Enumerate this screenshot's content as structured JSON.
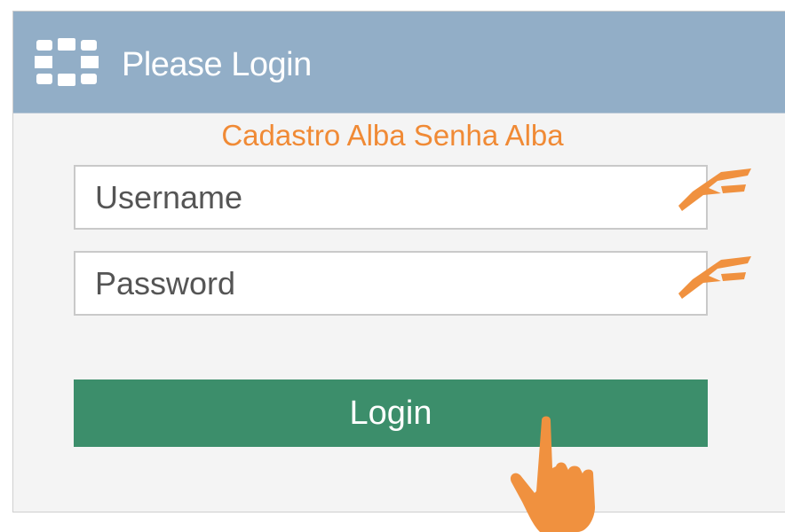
{
  "header": {
    "title": "Please Login",
    "logo_icon": "fortinet-logo-icon",
    "background_color": "#92aec7"
  },
  "annotation": {
    "text": "Cadastro Alba Senha Alba",
    "color": "#f08a35",
    "pointer_icon": "hand-pointer-icon",
    "field_mark_icon": "arrow-mark-icon"
  },
  "form": {
    "username_placeholder": "Username",
    "password_placeholder": "Password",
    "login_label": "Login",
    "login_color": "#3c8e6b"
  }
}
